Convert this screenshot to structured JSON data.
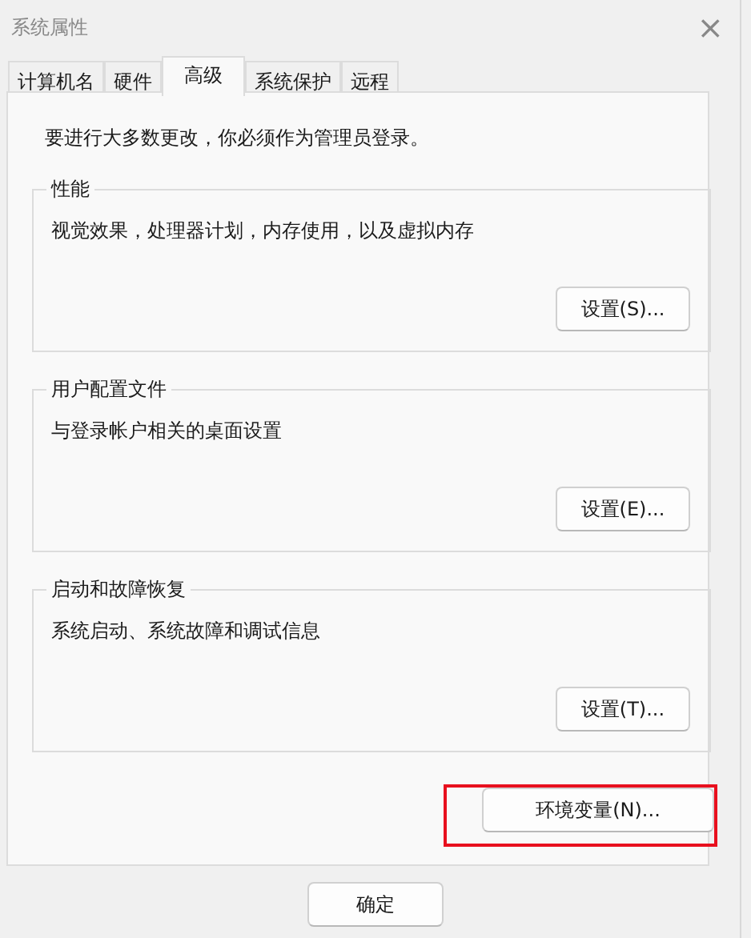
{
  "window": {
    "title": "系统属性",
    "close": "×"
  },
  "tabs": [
    {
      "label": "计算机名",
      "selected": false
    },
    {
      "label": "硬件",
      "selected": false
    },
    {
      "label": "高级",
      "selected": true
    },
    {
      "label": "系统保护",
      "selected": false
    },
    {
      "label": "远程",
      "selected": false
    }
  ],
  "notice": "要进行大多数更改，你必须作为管理员登录。",
  "groups": [
    {
      "title": "性能",
      "description": "视觉效果，处理器计划，内存使用，以及虚拟内存",
      "button": "设置(S)..."
    },
    {
      "title": "用户配置文件",
      "description": "与登录帐户相关的桌面设置",
      "button": "设置(E)..."
    },
    {
      "title": "启动和故障恢复",
      "description": "系统启动、系统故障和调试信息",
      "button": "设置(T)..."
    }
  ],
  "env_button": {
    "label": "环境变量(N)...",
    "highlighted": true
  },
  "dialog_buttons": [
    "确定"
  ]
}
